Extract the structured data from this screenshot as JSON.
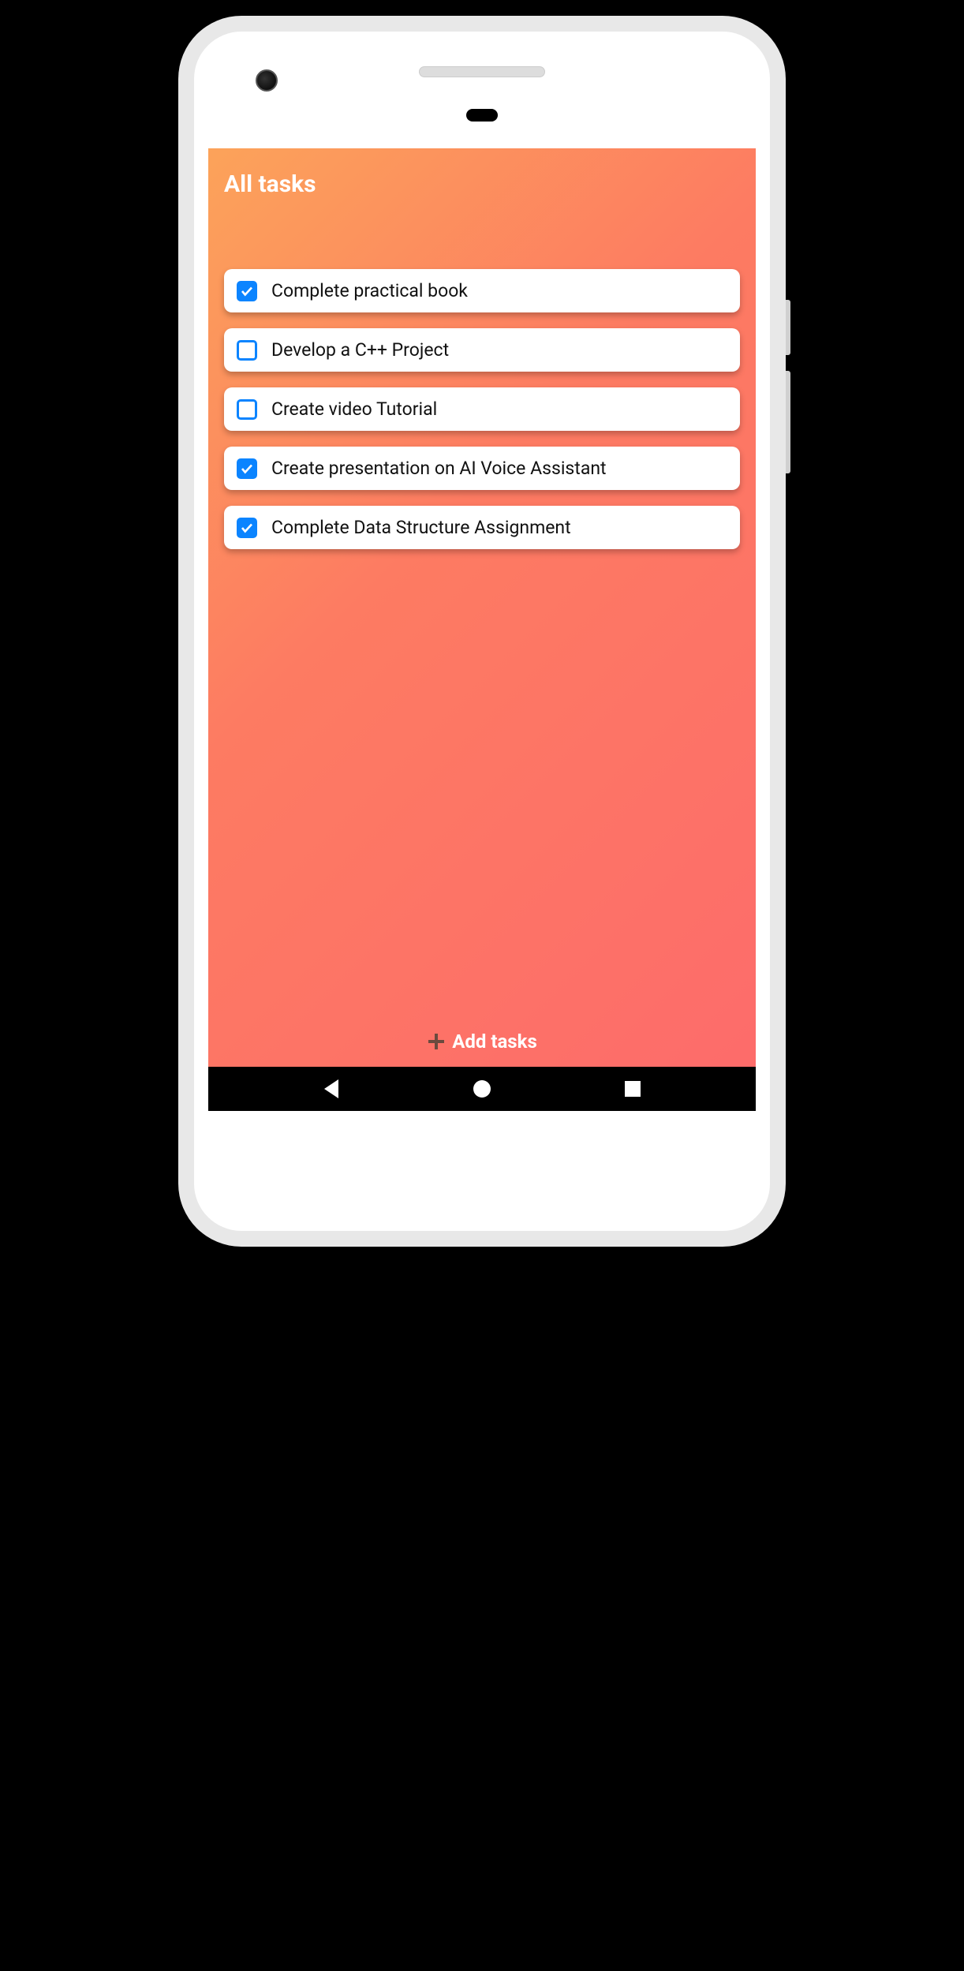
{
  "header": {
    "title": "All tasks"
  },
  "tasks": [
    {
      "label": "Complete practical book",
      "checked": true
    },
    {
      "label": "Develop a C++ Project",
      "checked": false
    },
    {
      "label": "Create video Tutorial",
      "checked": false
    },
    {
      "label": "Create presentation on AI Voice Assistant",
      "checked": true
    },
    {
      "label": "Complete Data Structure Assignment",
      "checked": true
    }
  ],
  "footer": {
    "add_label": "Add tasks"
  }
}
